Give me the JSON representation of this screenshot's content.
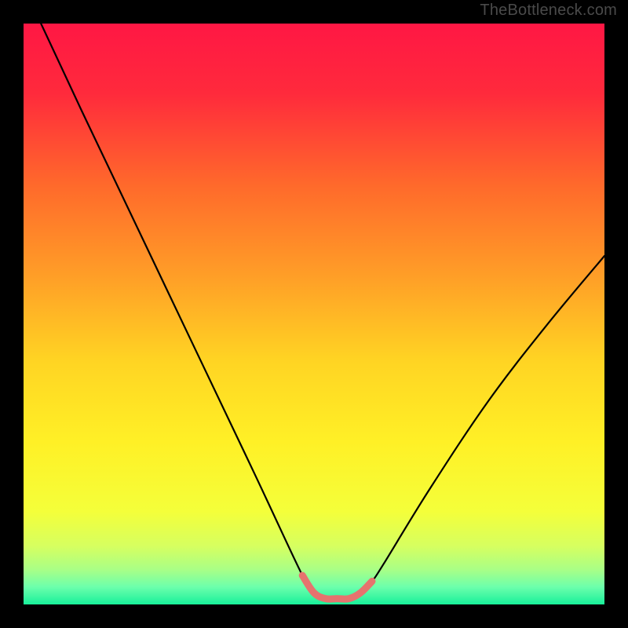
{
  "watermark": "TheBottleneck.com",
  "chart_data": {
    "type": "line",
    "title": "",
    "xlabel": "",
    "ylabel": "",
    "xlim": [
      0,
      100
    ],
    "ylim": [
      0,
      100
    ],
    "series": [
      {
        "name": "bottleneck-curve",
        "x": [
          3,
          10,
          20,
          30,
          40,
          48,
          50,
          52,
          54,
          56,
          58,
          60,
          62,
          70,
          80,
          90,
          100
        ],
        "values": [
          100,
          85,
          64,
          43,
          22,
          5,
          2,
          1,
          1,
          1,
          2,
          4,
          7,
          20,
          35,
          48,
          60
        ]
      }
    ],
    "annotations": [
      {
        "name": "flat-bottom-highlight",
        "color": "#e6736e",
        "x": [
          48,
          50,
          52,
          54,
          56,
          58,
          60
        ],
        "values": [
          5,
          2,
          1,
          1,
          1,
          2,
          4
        ]
      }
    ],
    "background": {
      "type": "rainbow-gradient",
      "stops": [
        {
          "offset": 0.0,
          "color": "#ff1744"
        },
        {
          "offset": 0.12,
          "color": "#ff2a3c"
        },
        {
          "offset": 0.28,
          "color": "#ff6a2b"
        },
        {
          "offset": 0.44,
          "color": "#ffa027"
        },
        {
          "offset": 0.58,
          "color": "#ffd423"
        },
        {
          "offset": 0.72,
          "color": "#fff026"
        },
        {
          "offset": 0.84,
          "color": "#f4ff3a"
        },
        {
          "offset": 0.9,
          "color": "#d6ff60"
        },
        {
          "offset": 0.94,
          "color": "#a9ff86"
        },
        {
          "offset": 0.97,
          "color": "#6cffac"
        },
        {
          "offset": 1.0,
          "color": "#18f09a"
        }
      ]
    }
  }
}
